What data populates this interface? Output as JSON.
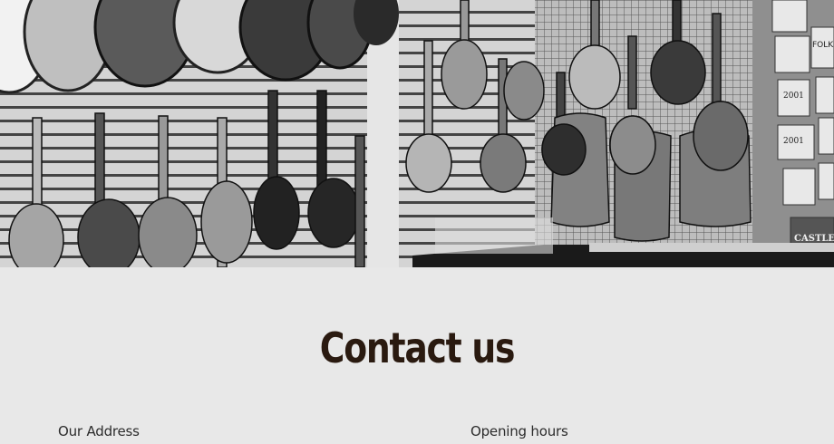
{
  "hero": {
    "image_name": "ukulele-wall-photo",
    "string_labels": [
      "FOLK SINGER",
      "2001",
      "2001",
      "CASTLE"
    ]
  },
  "contact": {
    "title": "Contact us",
    "address_label": "Our Address",
    "hours_label": "Opening hours"
  },
  "colors": {
    "background": "#e8e8e8",
    "title": "#2a1a10",
    "text": "#2c2c2c"
  }
}
